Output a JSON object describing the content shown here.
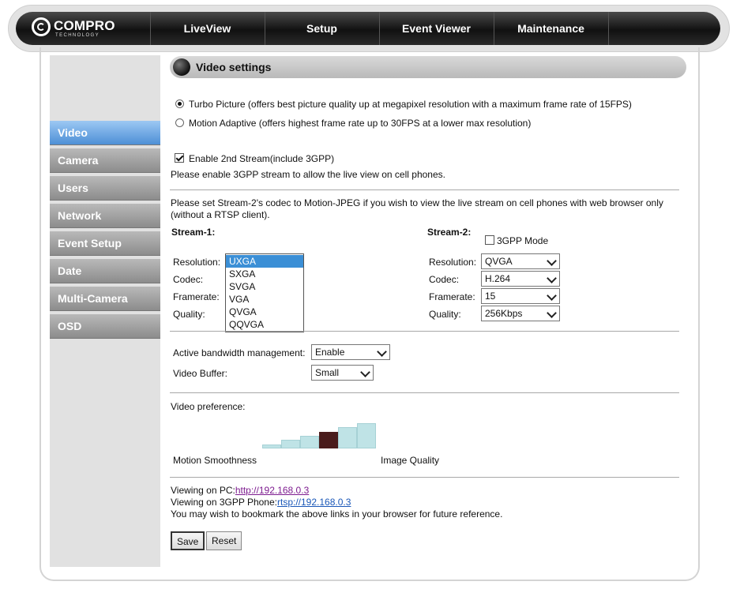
{
  "nav": {
    "logo": "COMPRO",
    "logo_sub": "TECHNOLOGY",
    "items": [
      "LiveView",
      "Setup",
      "Event Viewer",
      "Maintenance"
    ]
  },
  "sidebar": {
    "items": [
      {
        "label": "Video",
        "active": true
      },
      {
        "label": "Camera",
        "active": false
      },
      {
        "label": "Users",
        "active": false
      },
      {
        "label": "Network",
        "active": false
      },
      {
        "label": "Event Setup",
        "active": false
      },
      {
        "label": "Date",
        "active": false
      },
      {
        "label": "Multi-Camera",
        "active": false
      },
      {
        "label": "OSD",
        "active": false
      }
    ]
  },
  "header": {
    "title": "Video settings"
  },
  "mode": {
    "turbo": "Turbo Picture (offers best picture quality up at megapixel resolution with a maximum frame rate of 15FPS)",
    "motion": "Motion Adaptive (offers highest frame rate up to 30FPS at a lower max resolution)",
    "selected": "turbo"
  },
  "stream2": {
    "checkbox": "Enable 2nd Stream(include 3GPP)",
    "checked": true,
    "note": "Please enable 3GPP stream to allow the live view on cell phones."
  },
  "codec_note": {
    "line1": "Please set Stream-2's codec to Motion-JPEG if you wish to view the live stream on cell phones with web browser only",
    "line2": "(without a RTSP client)."
  },
  "stream1": {
    "title": "Stream-1:",
    "labels": {
      "resolution": "Resolution:",
      "codec": "Codec:",
      "framerate": "Framerate:",
      "quality": "Quality:"
    },
    "resolution_options": [
      "UXGA",
      "SXGA",
      "SVGA",
      "VGA",
      "QVGA",
      "QQVGA"
    ],
    "resolution_selected": "UXGA"
  },
  "stream2_settings": {
    "title": "Stream-2:",
    "mode_label": "3GPP Mode",
    "mode_checked": false,
    "labels": {
      "resolution": "Resolution:",
      "codec": "Codec:",
      "framerate": "Framerate:",
      "quality": "Quality:"
    },
    "resolution": "QVGA",
    "codec": "H.264",
    "framerate": "15",
    "quality": "256Kbps"
  },
  "bandwidth": {
    "label": "Active bandwidth management:",
    "value": "Enable",
    "buffer_label": "Video Buffer:",
    "buffer_value": "Small"
  },
  "preference": {
    "label": "Video preference:",
    "left_label": "Motion Smoothness",
    "right_label": "Image Quality",
    "levels": 6,
    "selected_level": 4
  },
  "links": {
    "pc_label": "Viewing on PC:",
    "pc_url": "http://192.168.0.3",
    "phone_label": "Viewing on 3GPP Phone:",
    "phone_url": "rtsp://192.168.0.3",
    "note": "You may wish to bookmark the above links in your browser for future reference."
  },
  "buttons": {
    "save": "Save",
    "reset": "Reset"
  },
  "colors": {
    "active_nav": "#4d8fd6",
    "selected_bar": "#4a1c1c",
    "bar": "#bfe3e6"
  }
}
